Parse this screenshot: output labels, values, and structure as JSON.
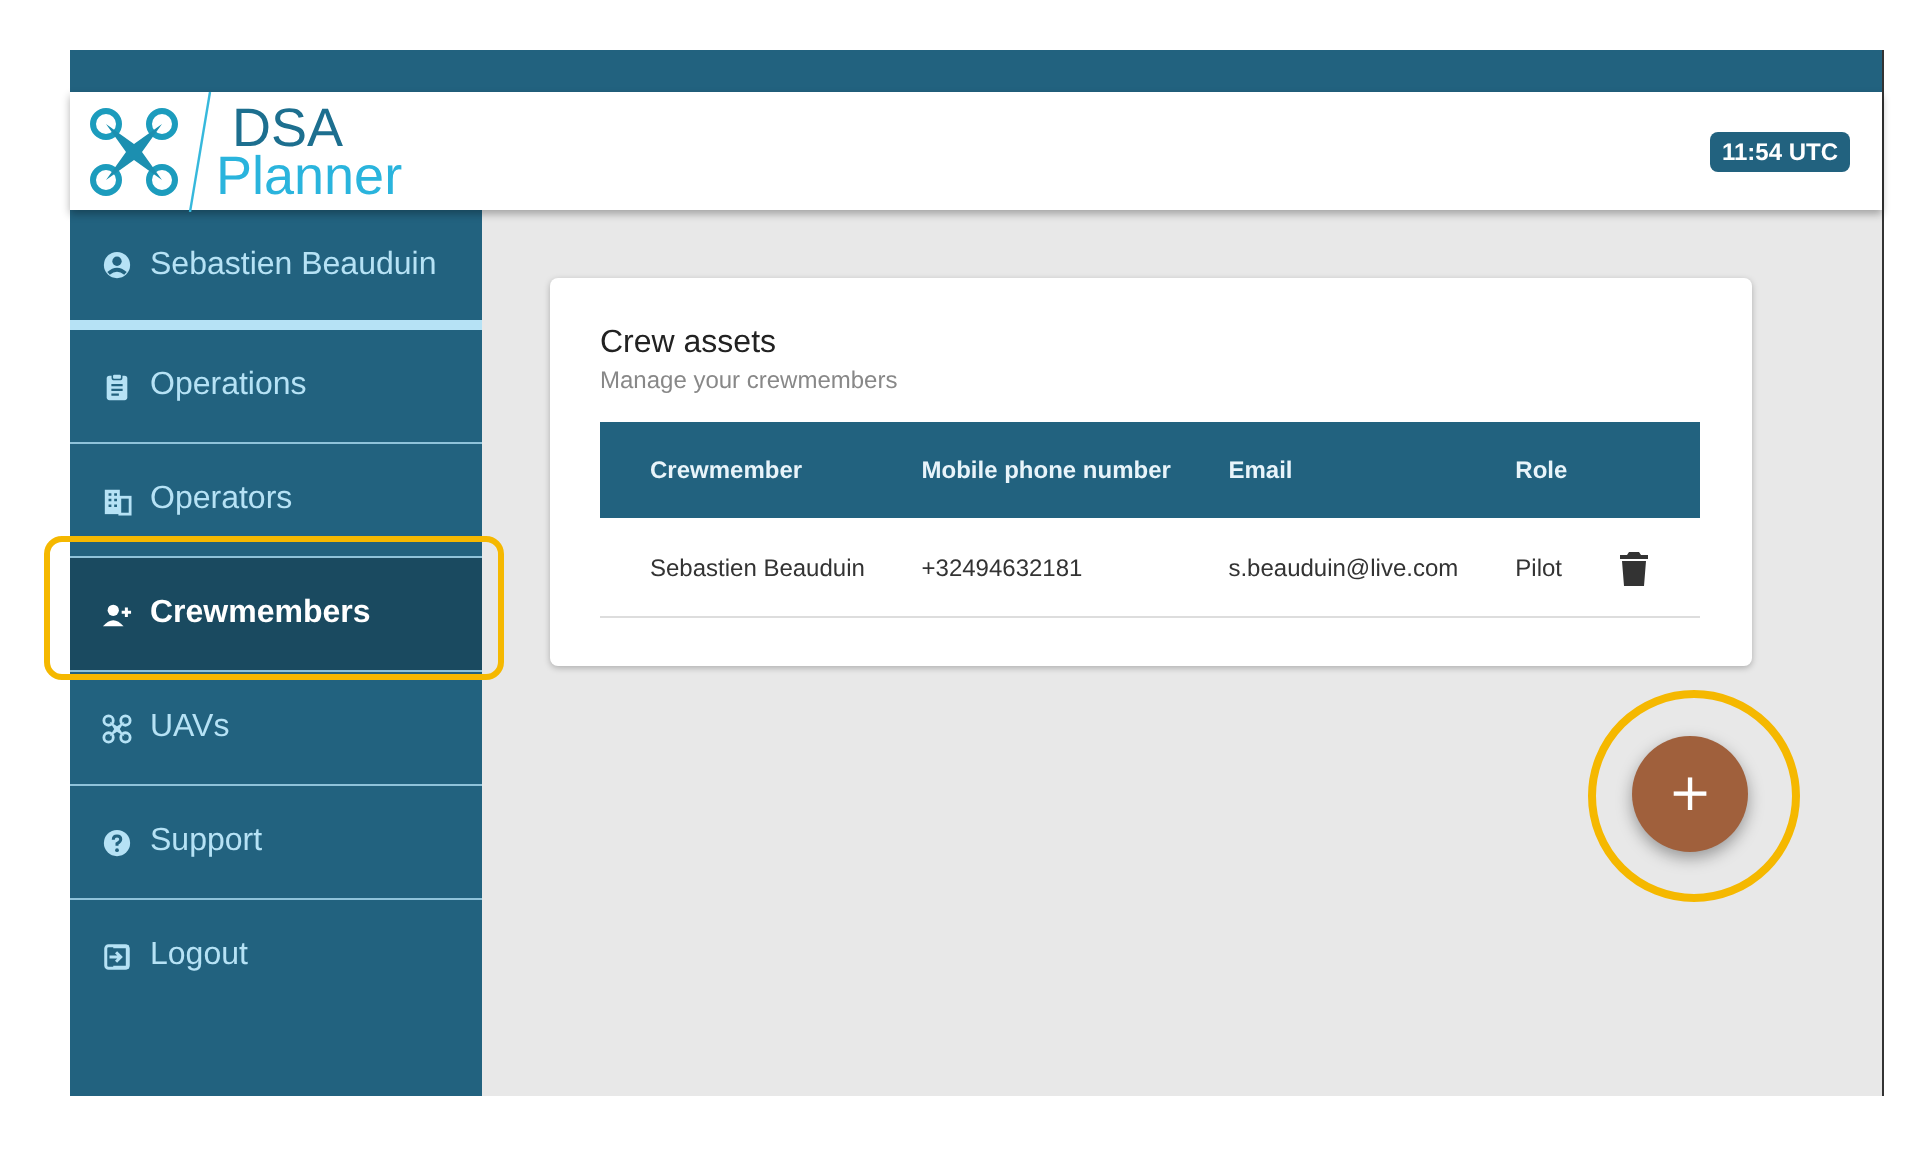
{
  "header": {
    "logo_top": "DSA",
    "logo_bottom": "Planner",
    "clock": "11:54 UTC"
  },
  "sidebar": {
    "user": "Sebastien Beauduin",
    "items": [
      {
        "label": "Operations",
        "selected": false
      },
      {
        "label": "Operators",
        "selected": false
      },
      {
        "label": "Crewmembers",
        "selected": true
      },
      {
        "label": "UAVs",
        "selected": false
      },
      {
        "label": "Support",
        "selected": false
      },
      {
        "label": "Logout",
        "selected": false
      }
    ]
  },
  "card": {
    "title": "Crew assets",
    "subtitle": "Manage your crewmembers",
    "table": {
      "columns": [
        "Crewmember",
        "Mobile phone number",
        "Email",
        "Role"
      ],
      "rows": [
        {
          "cells": [
            "Sebastien Beauduin",
            "+32494632181",
            "s.beauduin@live.com",
            "Pilot"
          ]
        }
      ]
    }
  },
  "fab": {
    "label": "+"
  }
}
